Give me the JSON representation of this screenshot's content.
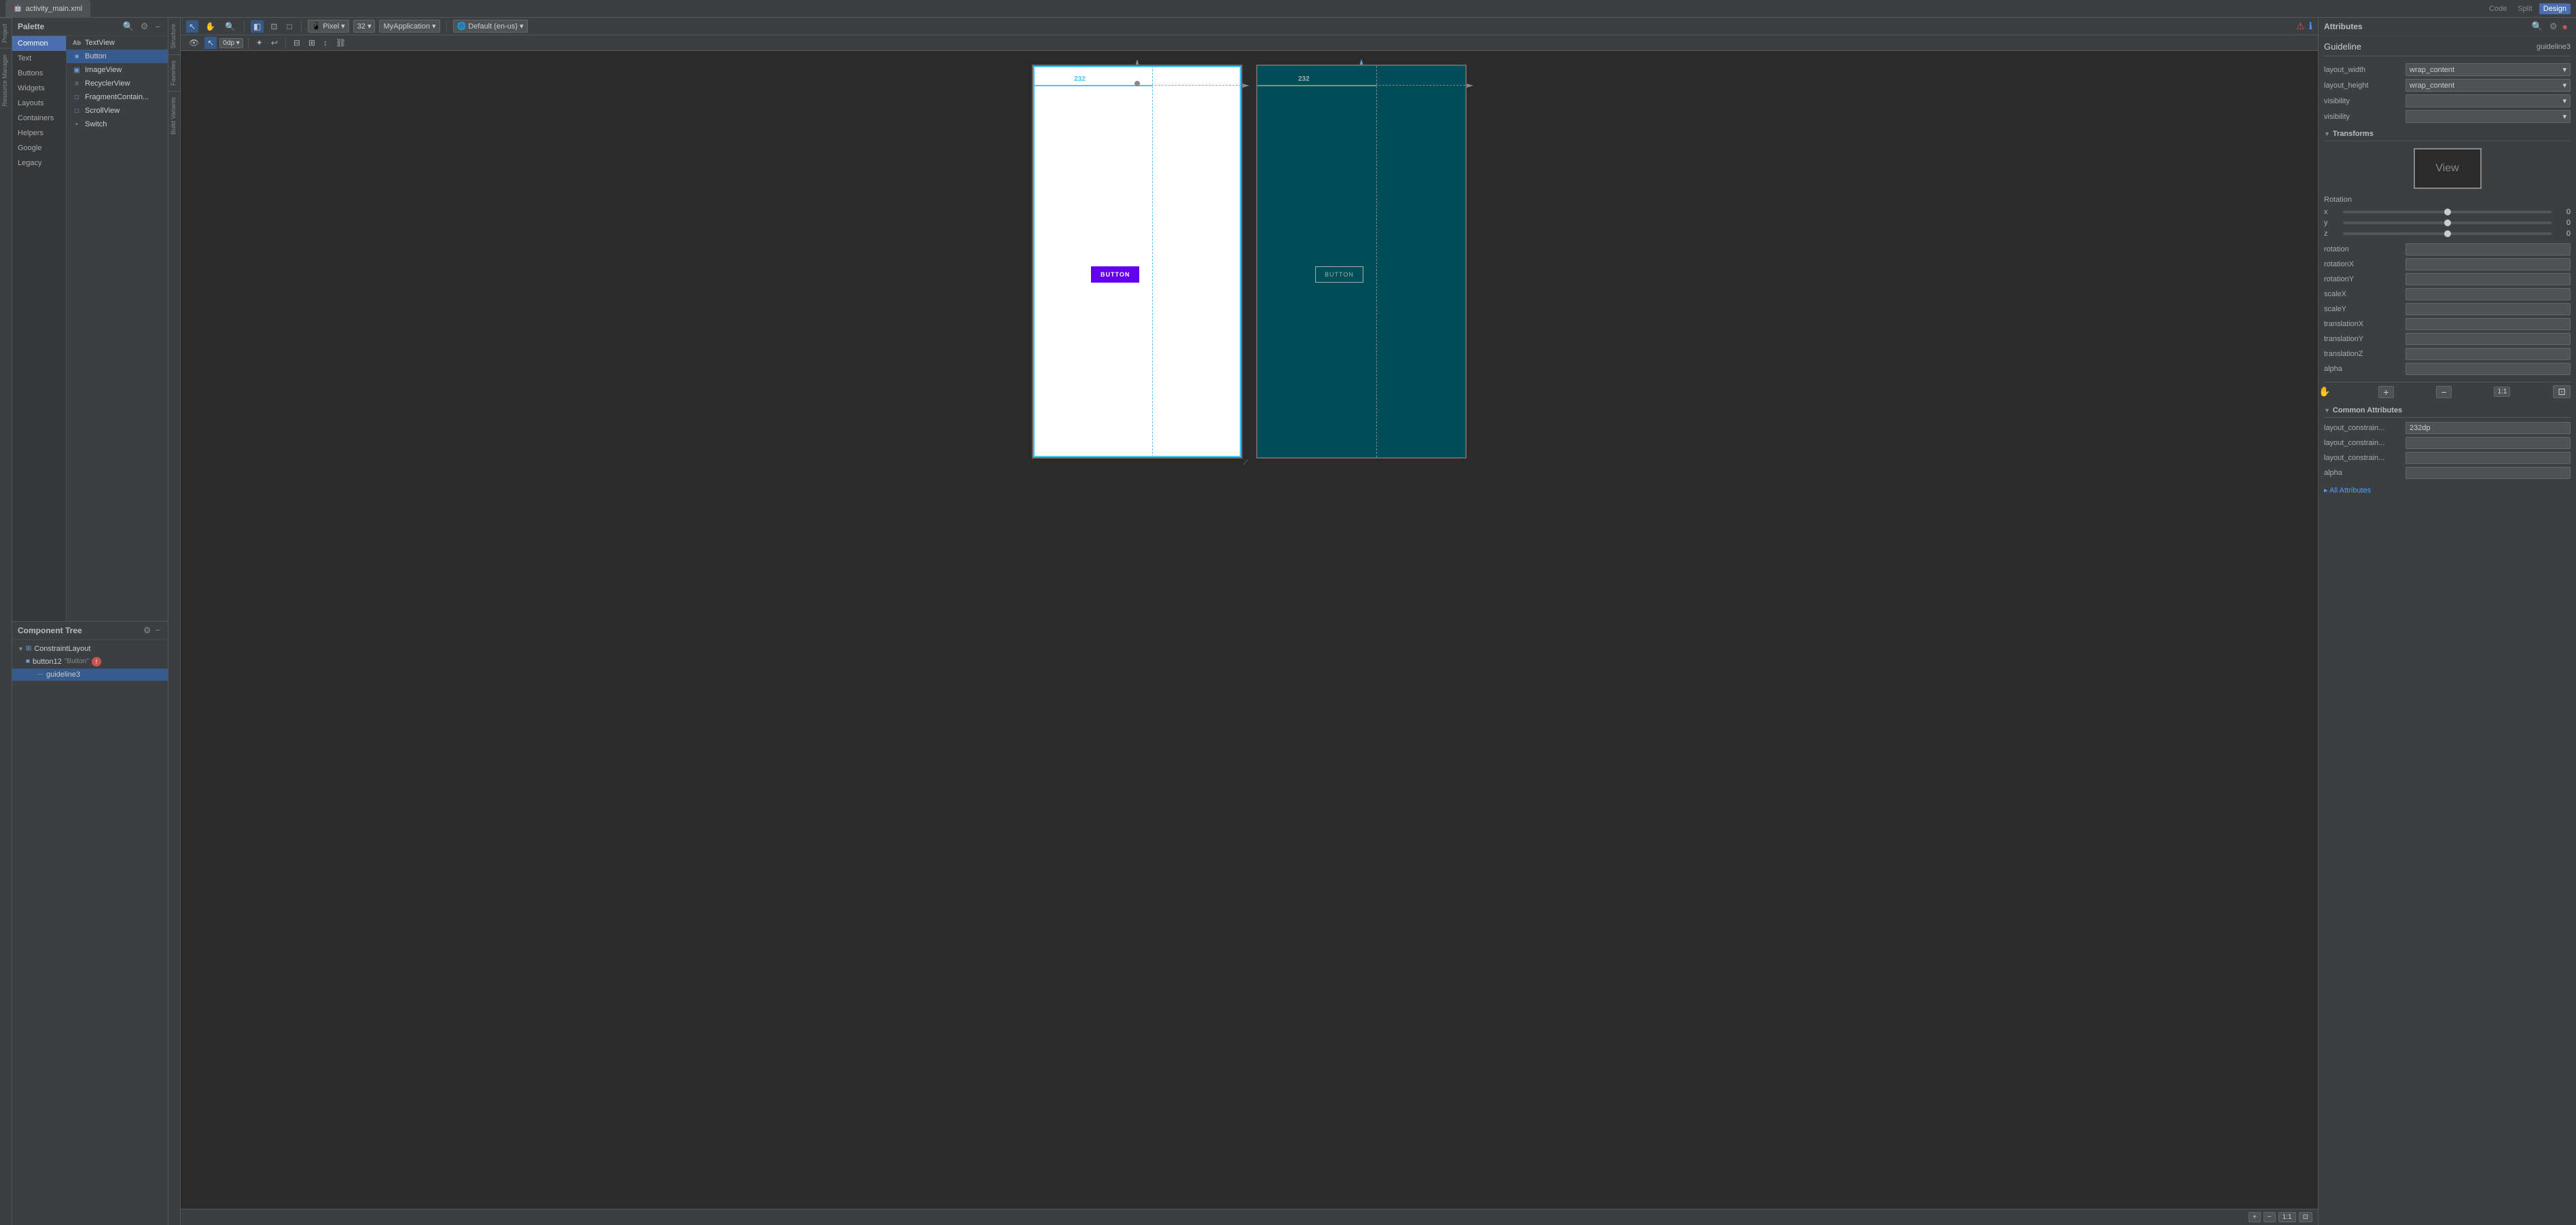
{
  "topbar": {
    "tab_label": "activity_main.xml"
  },
  "toolbar_right": {
    "code_label": "Code",
    "split_label": "Split",
    "design_label": "Design"
  },
  "palette": {
    "title": "Palette",
    "categories": [
      {
        "id": "common",
        "label": "Common",
        "active": true
      },
      {
        "id": "text",
        "label": "Text"
      },
      {
        "id": "buttons",
        "label": "Buttons"
      },
      {
        "id": "widgets",
        "label": "Widgets"
      },
      {
        "id": "layouts",
        "label": "Layouts"
      },
      {
        "id": "containers",
        "label": "Containers"
      },
      {
        "id": "helpers",
        "label": "Helpers"
      },
      {
        "id": "google",
        "label": "Google"
      },
      {
        "id": "legacy",
        "label": "Legacy"
      }
    ],
    "items": [
      {
        "id": "textview",
        "label": "TextView",
        "icon": "Ab"
      },
      {
        "id": "button",
        "label": "Button",
        "icon": "□"
      },
      {
        "id": "imageview",
        "label": "ImageView",
        "icon": "▣"
      },
      {
        "id": "recyclerview",
        "label": "RecyclerView",
        "icon": "≡"
      },
      {
        "id": "fragmentcontainer",
        "label": "FragmentContain...",
        "icon": "□"
      },
      {
        "id": "scrollview",
        "label": "ScrollView",
        "icon": "□"
      },
      {
        "id": "switch",
        "label": "Switch",
        "icon": "▪"
      }
    ]
  },
  "design_toolbar": {
    "device_label": "Pixel",
    "api_label": "32",
    "app_label": "MyApplication",
    "locale_label": "Default (en-us)"
  },
  "canvas": {
    "light_phone": {
      "button_label": "BUTTON",
      "dim_label": "232",
      "guideline_pos": "232"
    },
    "dark_phone": {
      "button_label": "BUTTON",
      "dim_label": "232"
    }
  },
  "component_tree": {
    "title": "Component Tree",
    "items": [
      {
        "id": "constraint",
        "label": "ConstraintLayout",
        "indent": 0,
        "has_arrow": true,
        "icon": "⊞"
      },
      {
        "id": "button12",
        "label": "button12",
        "sublabel": "\"Button\"",
        "indent": 1,
        "has_error": true,
        "icon": "□"
      },
      {
        "id": "guideline3",
        "label": "guideline3",
        "indent": 2,
        "icon": "—"
      }
    ]
  },
  "attributes": {
    "title": "Attributes",
    "tabs": [
      {
        "id": "code",
        "label": "Code"
      },
      {
        "id": "split",
        "label": "Split"
      },
      {
        "id": "design",
        "label": "Design",
        "active": true
      }
    ],
    "element_name": "Guideline",
    "element_id": "guideline3",
    "layout_width": {
      "label": "layout_width",
      "value": "wrap_content"
    },
    "layout_height": {
      "label": "layout_height",
      "value": "wrap_content"
    },
    "visibility_label": "visibility",
    "visibility_label2": "visibility",
    "transforms": {
      "title": "Transforms",
      "view_label": "View"
    },
    "rotation": {
      "title": "Rotation",
      "x_label": "x",
      "x_value": "0",
      "y_label": "y",
      "y_value": "0",
      "z_label": "z",
      "z_value": "0",
      "rotation_label": "rotation",
      "rotationX_label": "rotationX",
      "rotationY_label": "rotationY",
      "scaleX_label": "scaleX",
      "scaleY_label": "scaleY",
      "translationX_label": "translationX",
      "translationY_label": "translationY",
      "translationZ_label": "translationZ",
      "alpha_label": "alpha"
    },
    "common": {
      "title": "Common Attributes",
      "layout_constrain1_label": "layout_constrain...",
      "layout_constrain1_value": "232dp",
      "layout_constrain2_label": "layout_constrain...",
      "layout_constrain2_value": "",
      "layout_constrain3_label": "layout_constrain...",
      "layout_constrain3_value": "",
      "alpha_label": "alpha",
      "alpha_value": ""
    },
    "all_attr_label": "▸ All Attributes"
  },
  "bottom": {
    "plus_label": "+",
    "minus_label": "−",
    "ratio_label": "1:1"
  },
  "side_tabs": [
    {
      "label": "Project"
    },
    {
      "label": "Resource Manager"
    },
    {
      "label": "Structure"
    },
    {
      "label": "Favorites"
    },
    {
      "label": "Build Variants"
    }
  ]
}
